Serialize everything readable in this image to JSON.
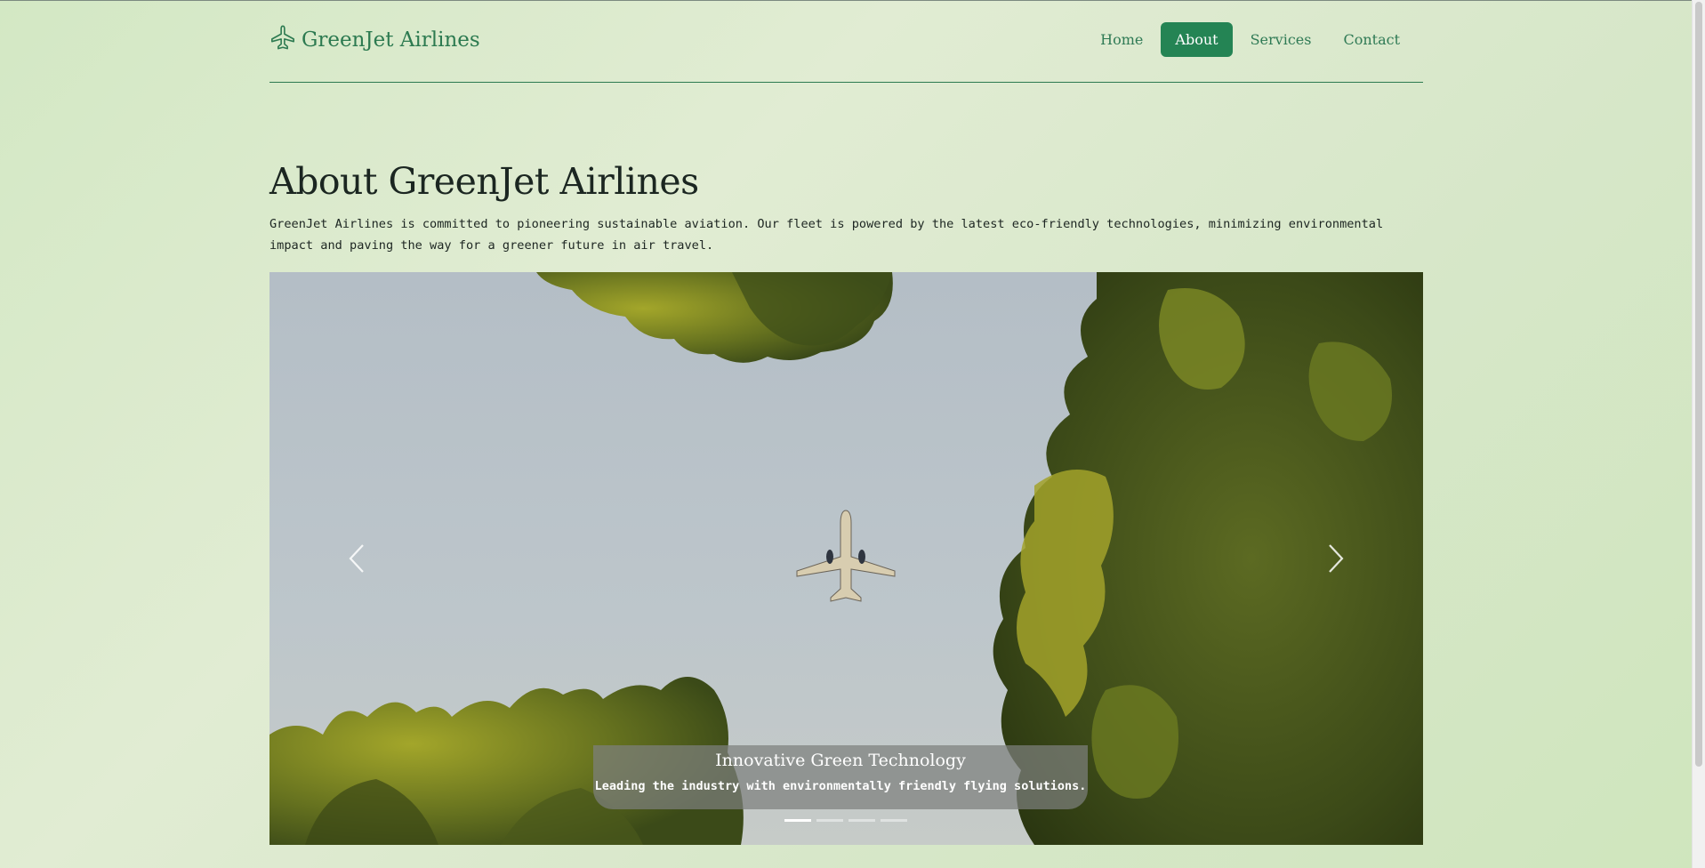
{
  "brand": {
    "name": "GreenJet Airlines",
    "icon": "airplane-icon",
    "color": "#2c7a50"
  },
  "nav": {
    "items": [
      {
        "label": "Home",
        "active": false
      },
      {
        "label": "About",
        "active": true
      },
      {
        "label": "Services",
        "active": false
      },
      {
        "label": "Contact",
        "active": false
      }
    ],
    "active_color": "#248454"
  },
  "about": {
    "title": "About GreenJet Airlines",
    "text": "GreenJet Airlines is committed to pioneering sustainable aviation. Our fleet is powered by the latest eco-friendly technologies, minimizing environmental impact and paving the way for a greener future in air travel."
  },
  "carousel": {
    "slide_count": 4,
    "active_index": 0,
    "caption_title": "Innovative Green Technology",
    "caption_text": "Leading the industry with environmentally friendly flying solutions.",
    "prev_icon": "chevron-left-icon",
    "next_icon": "chevron-right-icon"
  }
}
